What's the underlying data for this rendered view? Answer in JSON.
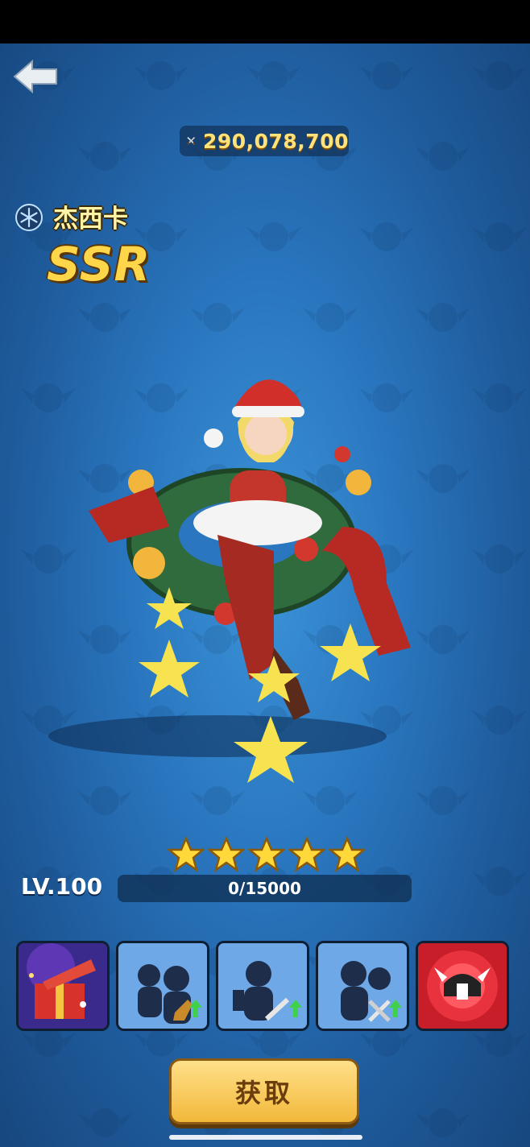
{
  "header": {
    "power_icon": "crossed-swords-icon",
    "power_value": "290,078,700"
  },
  "hero": {
    "element_icon": "snowflake-icon",
    "name": "杰西卡",
    "rarity": "SSR",
    "stars": 5,
    "level_label": "LV.100",
    "exp_text": "0/15000",
    "exp_fraction": 0
  },
  "equipment_slots": [
    {
      "name": "gift-box-slot",
      "icon": "gift-box-icon"
    },
    {
      "name": "boots-slot",
      "icon": "boots-icon"
    },
    {
      "name": "weapon-slot-1",
      "icon": "sword-icon"
    },
    {
      "name": "weapon-slot-2",
      "icon": "crossed-swords-icon"
    },
    {
      "name": "skill-slot",
      "icon": "viking-helmet-icon"
    }
  ],
  "actions": {
    "obtain_label": "获取"
  },
  "colors": {
    "accent_gold": "#ffd64a",
    "button_bg": "#f2b83a",
    "background": "#2a77c0"
  }
}
